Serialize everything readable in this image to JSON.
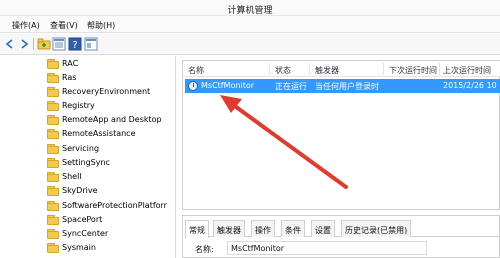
{
  "window": {
    "title": "计算机管理"
  },
  "menu": {
    "items": [
      "操作(A)",
      "查看(V)",
      "帮助(H)"
    ]
  },
  "toolbar": {
    "icons": [
      "back-icon",
      "forward-icon",
      "folder-icon",
      "details-icon",
      "help-icon",
      "properties-icon"
    ]
  },
  "tree": {
    "items": [
      "RAC",
      "Ras",
      "RecoveryEnvironment",
      "Registry",
      "RemoteApp and Desktop",
      "RemoteAssistance",
      "Servicing",
      "SettingSync",
      "Shell",
      "SkyDrive",
      "SoftwareProtectionPlatforr",
      "SpacePort",
      "SyncCenter",
      "Sysmain"
    ]
  },
  "list": {
    "columns": [
      "名称",
      "状态",
      "触发器",
      "下次运行时间",
      "上次运行时间"
    ],
    "rows": [
      {
        "name": "MsCtfMonitor",
        "status": "正在运行",
        "trigger": "当任何用户登录时",
        "next_run": "",
        "last_run": "2015/2/26 10"
      }
    ]
  },
  "detail": {
    "tabs": [
      "常规",
      "触发器",
      "操作",
      "条件",
      "设置",
      "历史记录(已禁用)"
    ],
    "name_label": "名称:",
    "name_value": "MsCtfMonitor"
  },
  "colors": {
    "selection": "#3399ff",
    "annotation_arrow": "#e23b2e"
  }
}
